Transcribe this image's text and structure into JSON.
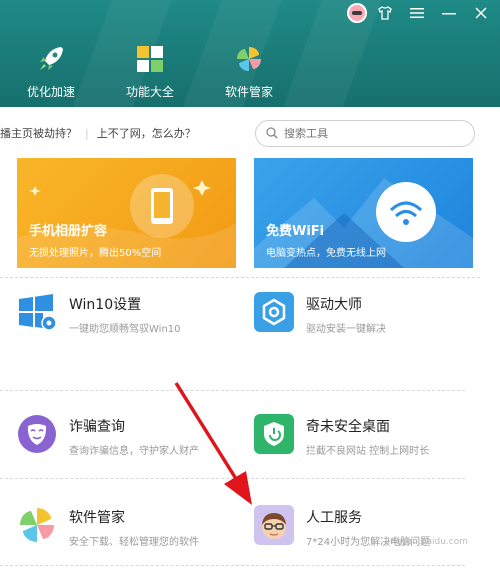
{
  "header": {
    "nav": [
      {
        "label": "优化加速",
        "icon": "rocket-icon"
      },
      {
        "label": "功能大全",
        "icon": "grid-icon"
      },
      {
        "label": "软件管家",
        "icon": "pinwheel-icon"
      }
    ],
    "window_controls": [
      "shirt-icon",
      "menu-icon",
      "minimize-icon",
      "close-icon"
    ]
  },
  "tips": [
    "播主页被劫持？",
    "上不了网，怎么办？"
  ],
  "search": {
    "placeholder": "搜索工具"
  },
  "banners": [
    {
      "title": "手机相册扩容",
      "subtitle": "无损处理照片，腾出50%空间",
      "color": "#f5a21a"
    },
    {
      "title": "免费WiFi",
      "subtitle": "电脑变热点，免费无线上网",
      "color": "#2a92e4"
    }
  ],
  "tools": [
    {
      "title": "Win10设置",
      "desc": "一键助您顺畅驾驭Win10",
      "icon": "windows-icon"
    },
    {
      "title": "驱动大师",
      "desc": "驱动安装一键解决",
      "icon": "hex-gear-icon"
    },
    {
      "title": "诈骗查询",
      "desc": "查询诈骗信息，守护家人财产",
      "icon": "mask-icon"
    },
    {
      "title": "奇未安全桌面",
      "desc": "拦截不良网站 控制上网时长",
      "icon": "shield-icon"
    },
    {
      "title": "软件管家",
      "desc": "安全下载、轻松管理您的软件",
      "icon": "pinwheel-icon"
    },
    {
      "title": "人工服务",
      "desc": "7*24小时为您解决电脑问题",
      "icon": "person-icon"
    }
  ],
  "watermark": "jingyan.baidu.com"
}
